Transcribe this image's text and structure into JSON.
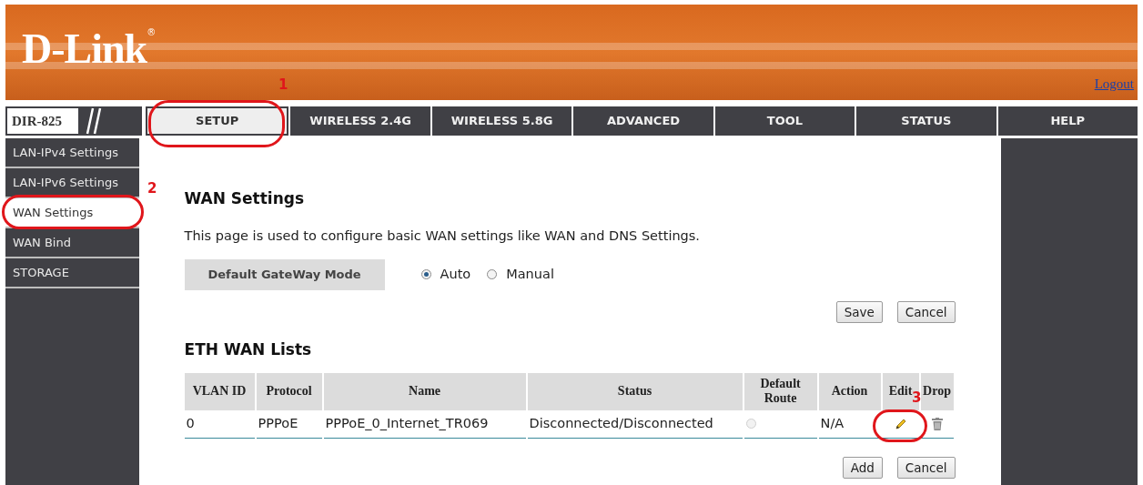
{
  "header": {
    "logo": "D-Link",
    "logo_mark": "®",
    "logout": "Logout"
  },
  "model": "DIR-825",
  "tabs": [
    {
      "label": "SETUP",
      "selected": true
    },
    {
      "label": "WIRELESS 2.4G",
      "selected": false
    },
    {
      "label": "WIRELESS 5.8G",
      "selected": false
    },
    {
      "label": "ADVANCED",
      "selected": false
    },
    {
      "label": "TOOL",
      "selected": false
    },
    {
      "label": "STATUS",
      "selected": false
    },
    {
      "label": "HELP",
      "selected": false
    }
  ],
  "sidebar": {
    "items": [
      {
        "label": "LAN-IPv4 Settings",
        "selected": false
      },
      {
        "label": "LAN-IPv6 Settings",
        "selected": false
      },
      {
        "label": "WAN Settings",
        "selected": true
      },
      {
        "label": "WAN Bind",
        "selected": false
      },
      {
        "label": "STORAGE",
        "selected": false
      }
    ]
  },
  "page": {
    "title": "WAN Settings",
    "description": "This page is used to configure basic WAN settings like WAN and DNS Settings.",
    "gateway_mode": {
      "label": "Default GateWay Mode",
      "options": [
        {
          "label": "Auto",
          "selected": true
        },
        {
          "label": "Manual",
          "selected": false
        }
      ]
    },
    "buttons": [
      "Save",
      "Cancel"
    ]
  },
  "eth_wan": {
    "title": "ETH WAN Lists",
    "columns": [
      "VLAN ID",
      "Protocol",
      "Name",
      "Status",
      "Default Route",
      "Action",
      "Edit",
      "Drop"
    ],
    "rows": [
      {
        "vlan_id": "0",
        "protocol": "PPPoE",
        "name": "PPPoE_0_Internet_TR069",
        "status": "Disconnected/Disconnected",
        "default_route": {
          "selected": false,
          "disabled": true
        },
        "action": "N/A"
      }
    ],
    "buttons": [
      "Add",
      "Cancel"
    ]
  },
  "annotations": [
    {
      "label": "1"
    },
    {
      "label": "2"
    },
    {
      "label": "3"
    }
  ]
}
